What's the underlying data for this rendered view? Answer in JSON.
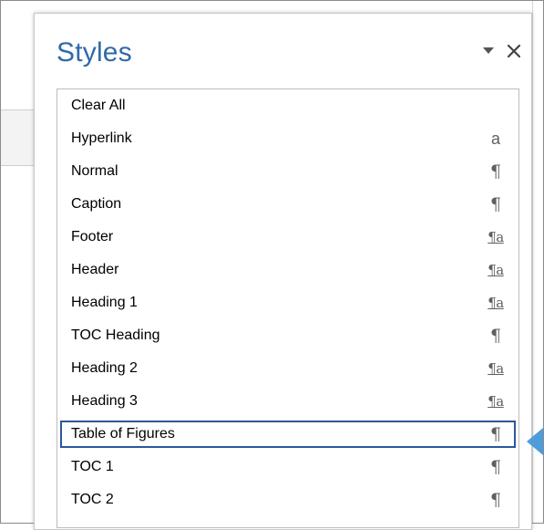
{
  "pane": {
    "title": "Styles",
    "collapse_icon": "dropdown-triangle-icon",
    "close_icon": "close-icon"
  },
  "style_list": {
    "items": [
      {
        "name": "Clear All",
        "glyph": "",
        "type": "none"
      },
      {
        "name": "Hyperlink",
        "glyph": "a",
        "type": "character"
      },
      {
        "name": "Normal",
        "glyph": "¶",
        "type": "paragraph"
      },
      {
        "name": "Caption",
        "glyph": "¶",
        "type": "paragraph"
      },
      {
        "name": "Footer",
        "glyph": "¶a",
        "type": "linked"
      },
      {
        "name": "Header",
        "glyph": "¶a",
        "type": "linked"
      },
      {
        "name": "Heading 1",
        "glyph": "¶a",
        "type": "linked"
      },
      {
        "name": "TOC Heading",
        "glyph": "¶",
        "type": "paragraph"
      },
      {
        "name": "Heading 2",
        "glyph": "¶a",
        "type": "linked"
      },
      {
        "name": "Heading 3",
        "glyph": "¶a",
        "type": "linked"
      },
      {
        "name": "Table of Figures",
        "glyph": "¶",
        "type": "paragraph",
        "selected": true
      },
      {
        "name": "TOC 1",
        "glyph": "¶",
        "type": "paragraph"
      },
      {
        "name": "TOC 2",
        "glyph": "¶",
        "type": "paragraph"
      }
    ]
  },
  "colors": {
    "title": "#2f6aa8",
    "selection_border": "#2b579a",
    "pointer_arrow": "#4f9cdc"
  }
}
